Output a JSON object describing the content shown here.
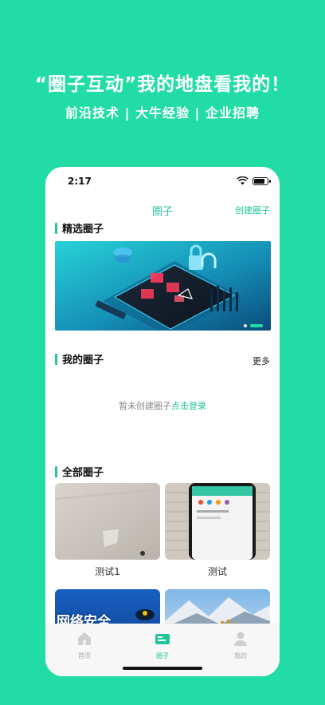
{
  "promo": {
    "headline": "“圈子互动”我的地盘看我的！",
    "tagline": "前沿技术 | 大牛经验 | 企业招聘"
  },
  "status": {
    "time": "2:17",
    "battery_level": 0.85
  },
  "nav": {
    "title": "圈子",
    "create_label": "创建圈子"
  },
  "sections": {
    "featured": {
      "title": "精选圈子",
      "banner_page_count": 2,
      "banner_active_index": 1
    },
    "mine": {
      "title": "我的圈子",
      "more_label": "更多",
      "empty_text": "暂未创建圈子",
      "login_link": "点击登录"
    },
    "all": {
      "title": "全部圈子",
      "cards": [
        {
          "label": "测试1"
        },
        {
          "label": "测试"
        },
        {
          "label": "",
          "image_text": "网络安全"
        },
        {
          "label": ""
        }
      ]
    }
  },
  "tabbar": {
    "items": [
      {
        "label": "首页",
        "icon": "home-icon",
        "active": false
      },
      {
        "label": "圈子",
        "icon": "circle-icon",
        "active": true
      },
      {
        "label": "我的",
        "icon": "user-icon",
        "active": false
      }
    ]
  },
  "colors": {
    "brand": "#22dca5",
    "accent": "#22c59a"
  }
}
